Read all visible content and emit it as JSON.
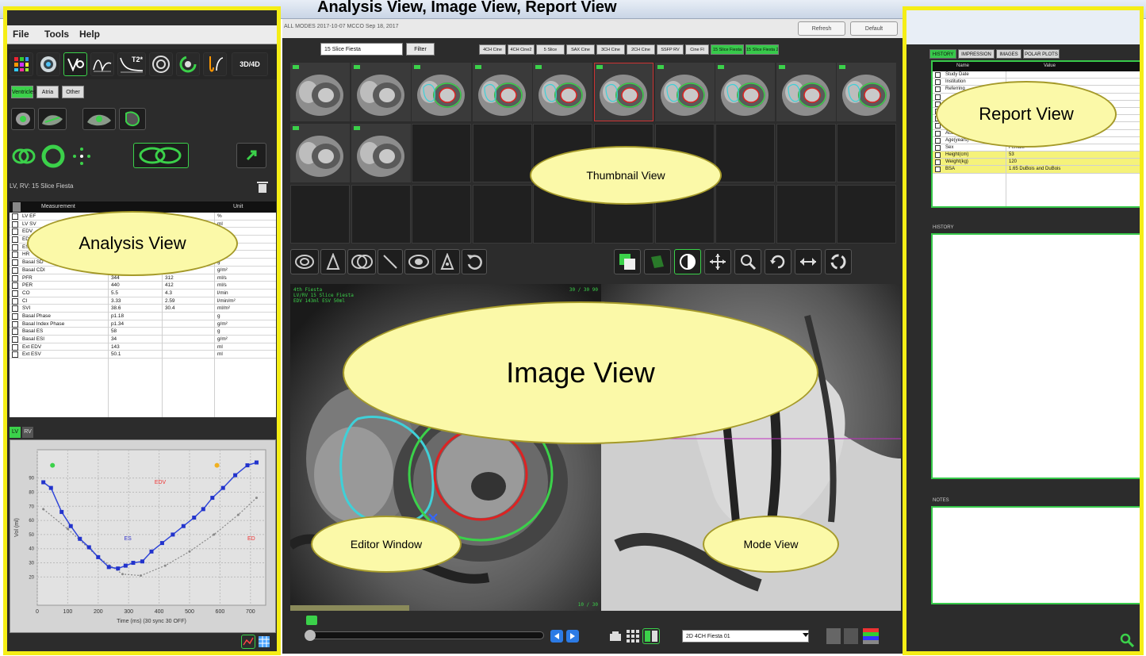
{
  "title_caption": "Analysis View, Image View, Report View",
  "menu": {
    "file": "File",
    "tools": "Tools",
    "help": "Help"
  },
  "mode_icons": [
    "viewer-icon",
    "function-icon",
    "flow-icon",
    "signal-curve-icon",
    "t2-star-icon",
    "myocardial-icon",
    "pulmonary-icon",
    "3d4d-icon"
  ],
  "mode_labels": {
    "t2": "T2*",
    "threed": "3D/4D"
  },
  "analysis_tabs": [
    "Ventricles",
    "Atria",
    "Other"
  ],
  "series_caption": "LV, RV: 15 Slice Fiesta",
  "analysis_table": {
    "headers": [
      "Measurement",
      "",
      "",
      "Unit"
    ],
    "rows": [
      [
        "LV EF",
        "",
        "",
        "%"
      ],
      [
        "LV SV",
        "",
        "",
        "ml"
      ],
      [
        "EDV",
        "",
        "",
        "ml"
      ],
      [
        "EDVI",
        "",
        "",
        "ml/m²"
      ],
      [
        "ESV",
        "",
        "",
        "ml"
      ],
      [
        "HR",
        "",
        "",
        "bpm"
      ],
      [
        "Basal SD",
        "54",
        "",
        "g"
      ],
      [
        "Basal CDI",
        "33",
        "",
        "g/m²"
      ],
      [
        "PFR",
        "344",
        "312",
        "ml/s"
      ],
      [
        "PER",
        "440",
        "412",
        "ml/s"
      ],
      [
        "CO",
        "5.5",
        "4.3",
        "l/min"
      ],
      [
        "CI",
        "3.33",
        "2.59",
        "l/min/m²"
      ],
      [
        "SVI",
        "38.6",
        "30.4",
        "ml/m²"
      ],
      [
        "Basal Phase",
        "p1.18",
        "",
        "g"
      ],
      [
        "Basal Index Phase",
        "p1.34",
        "",
        "g/m²"
      ],
      [
        "Basal ES",
        "58",
        "",
        "g"
      ],
      [
        "Basal ESI",
        "34",
        "",
        "g/m²"
      ],
      [
        "Ext EDV",
        "143",
        "",
        "ml"
      ],
      [
        "Ext ESV",
        "50.1",
        "",
        "ml"
      ]
    ]
  },
  "chart_tabs": [
    "LV",
    "RV"
  ],
  "chart_data": {
    "type": "line",
    "xlabel": "Time (ms)  (30 sync 30 OFF)",
    "ylabel": "Vol (ml)",
    "xlim": [
      0,
      750
    ],
    "ylim": [
      0,
      110
    ],
    "x_ticks": [
      "0",
      "100",
      "200",
      "300",
      "400",
      "500",
      "600",
      "700"
    ],
    "y_ticks": [
      "20",
      "30",
      "40",
      "50",
      "60",
      "70",
      "80",
      "90"
    ],
    "annotations": [
      "EDV",
      "ES",
      "ED"
    ],
    "series": [
      {
        "x": [
          20,
          45,
          80,
          110,
          140,
          170,
          200,
          235,
          265,
          290,
          315,
          345,
          375,
          410,
          445,
          480,
          515,
          545,
          575,
          610,
          650,
          690,
          720
        ],
        "values": [
          87,
          83,
          66,
          56,
          47,
          41,
          34,
          27,
          26,
          28,
          30,
          31,
          38,
          44,
          50,
          56,
          62,
          68,
          76,
          83,
          92,
          99,
          101
        ]
      },
      {
        "x": [
          20,
          100,
          200,
          280,
          340,
          420,
          500,
          580,
          660,
          720
        ],
        "values": [
          68,
          54,
          34,
          22,
          21,
          28,
          38,
          50,
          64,
          76
        ]
      }
    ]
  },
  "center": {
    "study_title": "ALL MODES 2017-10-07 MCCO  Sep 18, 2017",
    "btn_refresh": "Refresh",
    "btn_default": "Default",
    "series_select": "15 Slice Fiesta",
    "filter": "Filter",
    "series_chips": [
      "4CH Cine",
      "4CH Cine2",
      "5 Slice",
      "SAX Cine",
      "3CH Cine",
      "2CH Cine",
      "SSFP RV",
      "Cine Fl",
      "15 Slice Fiesta",
      "15 Slice Fiesta 2"
    ],
    "overlay_tl": "4th Fiesta\nLV/RV 15 Slice Fiesta\nEDV 143ml ESV 50ml",
    "overlay_tr": "30 / 30   90",
    "overlay_br": "10 / 30",
    "mode_select": "2D 4CH Fiesta 01"
  },
  "report": {
    "tabs": [
      "HISTORY",
      "IMPRESSION",
      "IMAGES",
      "POLAR PLOTS"
    ],
    "headers": [
      "",
      "Name",
      "Value"
    ],
    "rows": [
      [
        "Study Date",
        "",
        false
      ],
      [
        "Institution",
        "",
        false
      ],
      [
        "Referring",
        "",
        false
      ],
      [
        "",
        "",
        false
      ],
      [
        "",
        "",
        false
      ],
      [
        "",
        "",
        false
      ],
      [
        "",
        "",
        false
      ],
      [
        "",
        "",
        false
      ],
      [
        "Accession",
        "",
        false
      ],
      [
        "Age(years)",
        "12",
        false
      ],
      [
        "Sex",
        "Female",
        false
      ],
      [
        "Height(cm)",
        "53",
        true
      ],
      [
        "Weight(kg)",
        "120",
        true
      ],
      [
        "BSA",
        "1.65 DuBois and DuBois",
        true
      ]
    ],
    "history_caption": "HISTORY",
    "notes_caption": "NOTES"
  },
  "labels": {
    "report_view": "Report View",
    "thumbnail_view": "Thumbnail View",
    "analysis_view": "Analysis View",
    "image_view": "Image View",
    "editor_window": "Editor Window",
    "mode_view": "Mode View"
  },
  "colors": {
    "highlight_yellow": "#f5ee16",
    "active_green": "#37c94a",
    "bubble_fill": "#fbf9a8"
  }
}
